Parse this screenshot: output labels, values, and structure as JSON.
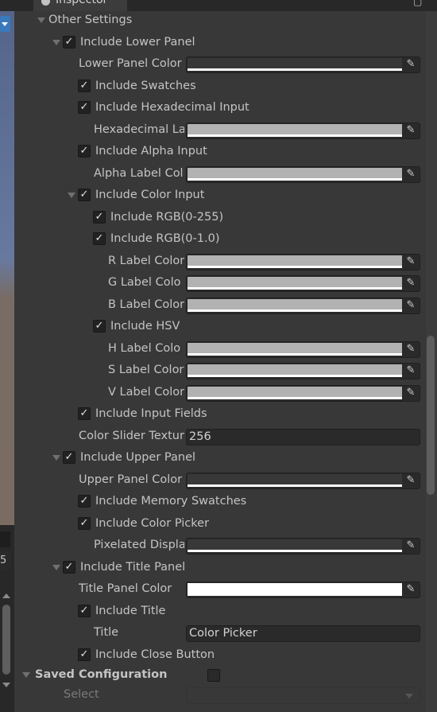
{
  "tab": {
    "title": "Inspector"
  },
  "left": {
    "number": "5"
  },
  "rows": {
    "other_settings": "Other Settings",
    "include_lower_panel": "Include Lower Panel",
    "lower_panel_color": "Lower Panel Color",
    "include_swatches": "Include Swatches",
    "include_hex_input": "Include Hexadecimal Input",
    "hex_label_color": "Hexadecimal La",
    "include_alpha_input": "Include Alpha Input",
    "alpha_label_color": "Alpha Label Col",
    "include_color_input": "Include Color Input",
    "include_rgb255": "Include RGB(0-255)",
    "include_rgb1": "Include RGB(0-1.0)",
    "r_label_color": "R Label Color",
    "g_label_color": "G Label Colo",
    "b_label_color": "B Label Color",
    "include_hsv": "Include HSV",
    "h_label_color": "H Label Colo",
    "s_label_color": "S Label Color",
    "v_label_color": "V Label Color",
    "include_input_fields": "Include Input Fields",
    "color_slider_texture": "Color Slider Textur",
    "color_slider_value": "256",
    "include_upper_panel": "Include Upper Panel",
    "upper_panel_color": "Upper Panel Color",
    "include_memory_swatches": "Include Memory Swatches",
    "include_color_picker": "Include Color Picker",
    "pixelated_display": "Pixelated Displa",
    "include_title_panel": "Include Title Panel",
    "title_panel_color": "Title Panel Color",
    "include_title": "Include Title",
    "title_label": "Title",
    "title_value": "Color Picker",
    "include_close_button": "Include Close Button",
    "saved_configuration": "Saved Configuration",
    "select_label": "Select"
  },
  "colors": {
    "white": "#ffffff",
    "grey": "#b2b2b2",
    "background": "#383838"
  },
  "icons": {
    "check": "✓",
    "picker": "eyedropper"
  }
}
